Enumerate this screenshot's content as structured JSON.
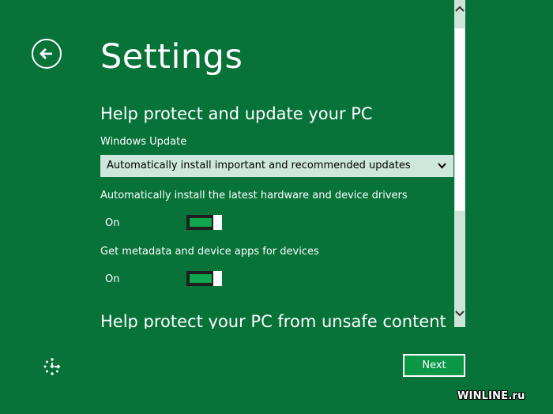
{
  "page": {
    "title": "Settings"
  },
  "back": {
    "icon": "back-arrow-icon"
  },
  "sections": {
    "protect_update": {
      "heading": "Help protect and update your PC",
      "windows_update": {
        "label": "Windows Update",
        "selected": "Automatically install important and recommended updates"
      },
      "drivers": {
        "label": "Automatically install the latest hardware and device drivers",
        "state": "On"
      },
      "metadata": {
        "label": "Get metadata and device apps for devices",
        "state": "On"
      }
    },
    "unsafe_content": {
      "heading": "Help protect your PC from unsafe content"
    }
  },
  "footer": {
    "next_label": "Next",
    "ease_icon": "ease-of-access-icon"
  },
  "watermark": "WINLINE.ru",
  "colors": {
    "background": "#077339",
    "toggle_on": "#10a64e",
    "dropdown_bg": "#cde7dc"
  }
}
